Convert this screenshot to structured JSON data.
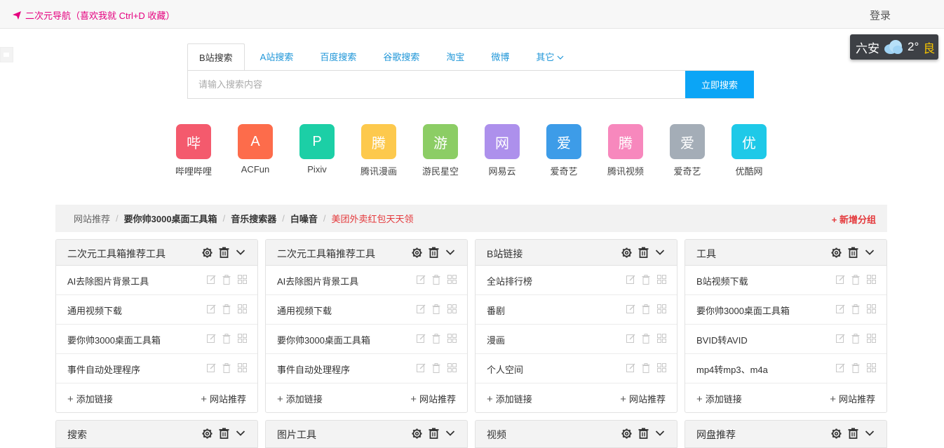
{
  "header": {
    "site_title": "二次元导航（喜欢我就 Ctrl+D 收藏）",
    "login_label": "登录"
  },
  "weather": {
    "city": "六安",
    "temperature": "2°",
    "air_quality": "良"
  },
  "search": {
    "tabs": [
      "B站搜索",
      "A站搜索",
      "百度搜索",
      "谷歌搜索",
      "淘宝",
      "微博",
      "其它"
    ],
    "placeholder": "请输入搜索内容",
    "button_label": "立即搜索"
  },
  "quick_links": [
    {
      "glyph": "哔",
      "label": "哔哩哔哩",
      "color": "#f45a6d"
    },
    {
      "glyph": "A",
      "label": "ACFun",
      "color": "#fd6c4b"
    },
    {
      "glyph": "P",
      "label": "Pixiv",
      "color": "#1ccfa6"
    },
    {
      "glyph": "腾",
      "label": "腾讯漫画",
      "color": "#fdc94d"
    },
    {
      "glyph": "游",
      "label": "游民星空",
      "color": "#8ccd65"
    },
    {
      "glyph": "网",
      "label": "网易云",
      "color": "#ad90ec"
    },
    {
      "glyph": "爱",
      "label": "爱奇艺",
      "color": "#3d9ce8"
    },
    {
      "glyph": "腾",
      "label": "腾讯视频",
      "color": "#f788bd"
    },
    {
      "glyph": "爱",
      "label": "爱奇艺",
      "color": "#a4adb7"
    },
    {
      "glyph": "优",
      "label": "优酷网",
      "color": "#1ec9e8"
    }
  ],
  "breadcrumb": {
    "items": [
      "网站推荐",
      "要你帅3000桌面工具箱",
      "音乐搜索器",
      "白噪音",
      "美团外卖红包天天领"
    ],
    "add_group_label": "+ 新增分组"
  },
  "cards": [
    {
      "title": "二次元工具箱推荐工具",
      "links": [
        "AI去除图片背景工具",
        "通用视频下载",
        "要你帅3000桌面工具箱",
        "事件自动处理程序"
      ]
    },
    {
      "title": "二次元工具箱推荐工具",
      "links": [
        "AI去除图片背景工具",
        "通用视频下载",
        "要你帅3000桌面工具箱",
        "事件自动处理程序"
      ]
    },
    {
      "title": "B站链接",
      "links": [
        "全站排行榜",
        "番剧",
        "漫画",
        "个人空间"
      ]
    },
    {
      "title": "工具",
      "links": [
        "B站视频下载",
        "要你帅3000桌面工具箱",
        "BVID转AVID",
        "mp4转mp3、m4a"
      ]
    }
  ],
  "card_footer": {
    "add_link_label": "添加链接",
    "recommend_label": "网站推荐"
  },
  "cards_row2": [
    "搜索",
    "图片工具",
    "视频",
    "网盘推荐"
  ]
}
